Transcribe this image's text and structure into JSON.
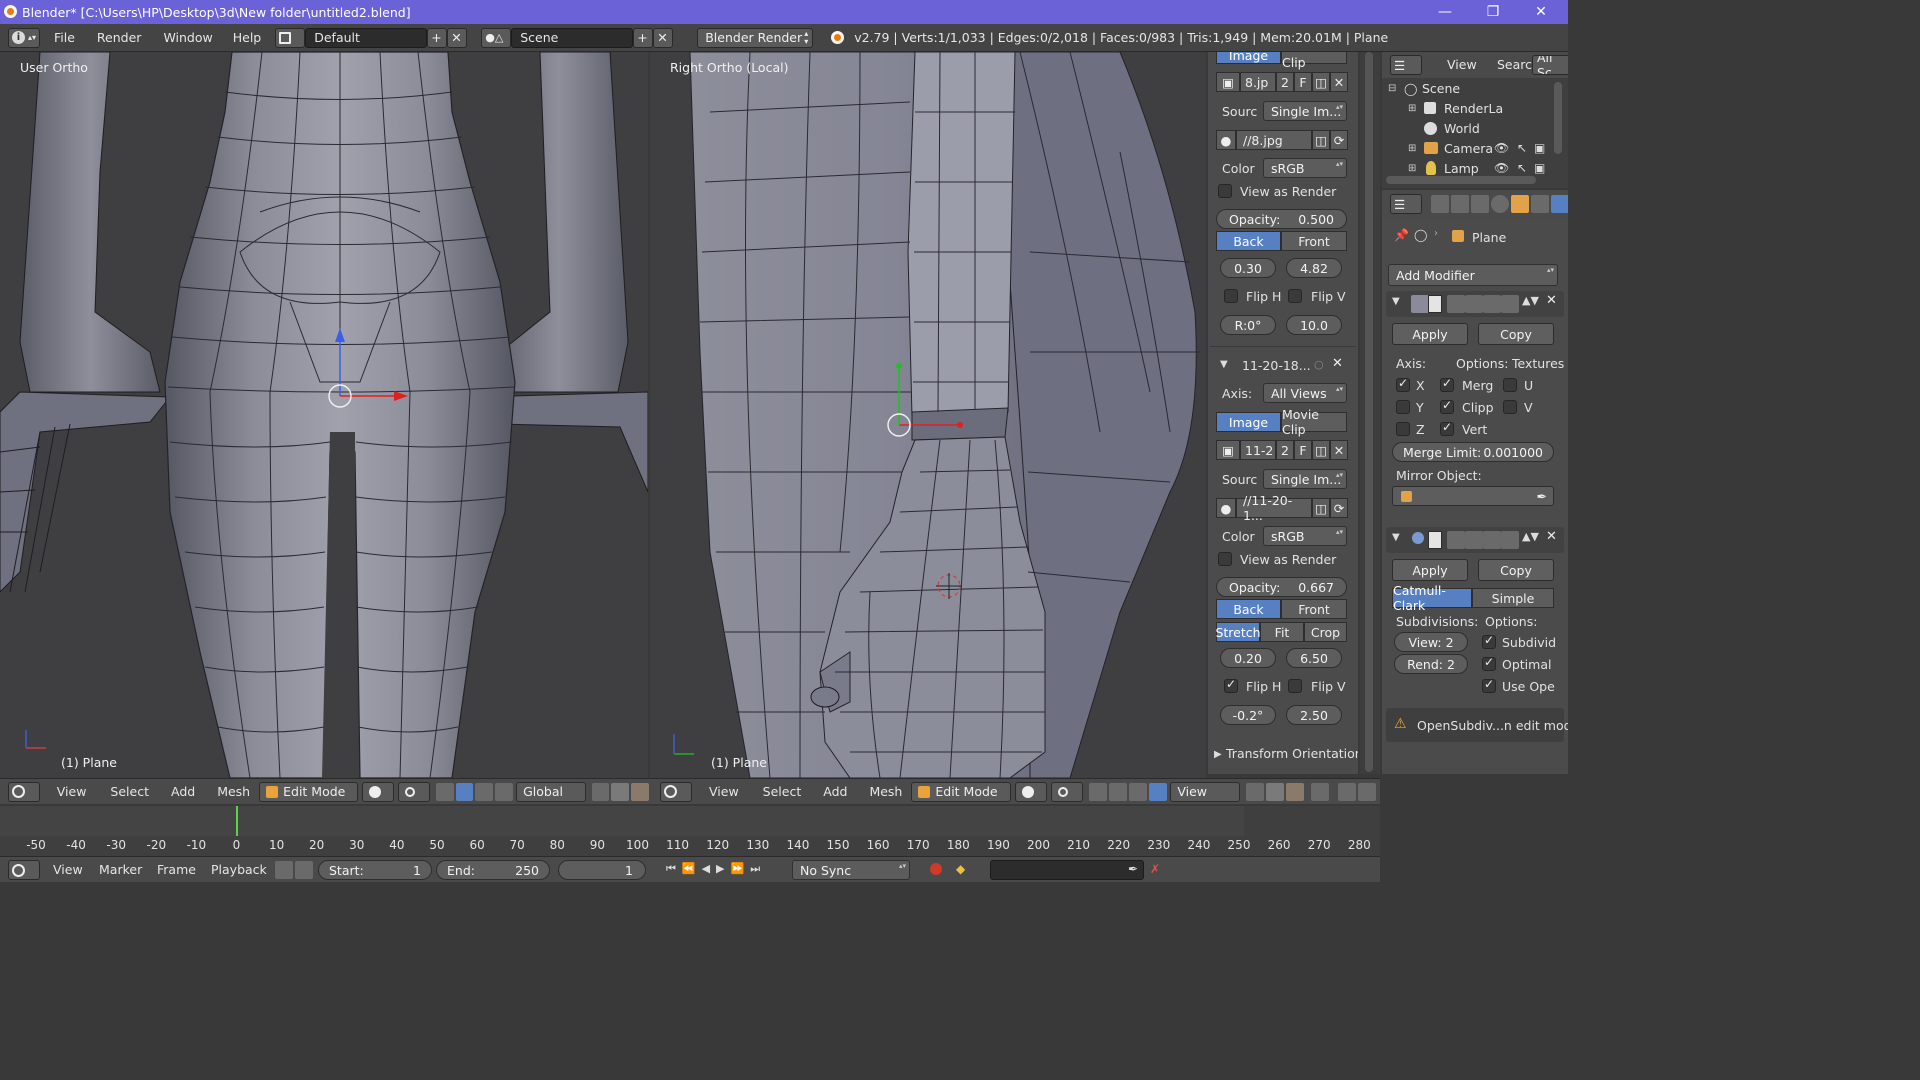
{
  "window": {
    "title": "Blender* [C:\\Users\\HP\\Desktop\\3d\\New folder\\untitled2.blend]",
    "minimize": "—",
    "maximize": "❐",
    "close": "✕"
  },
  "info_header": {
    "menus": [
      "File",
      "Render",
      "Window",
      "Help"
    ],
    "layout": "Default",
    "scene": "Scene",
    "engine": "Blender Render",
    "stats": "v2.79 | Verts:1/1,033 | Edges:0/2,018 | Faces:0/983 | Tris:1,949 | Mem:20.01M | Plane"
  },
  "viewport_left": {
    "label": "User Ortho",
    "object": "(1) Plane",
    "header": {
      "menus": [
        "View",
        "Select",
        "Add",
        "Mesh"
      ],
      "mode": "Edit Mode",
      "orientation": "Global"
    }
  },
  "viewport_right": {
    "label": "Right Ortho (Local)",
    "object": "(1) Plane",
    "header": {
      "menus": [
        "View",
        "Select",
        "Add",
        "Mesh"
      ],
      "mode": "Edit Mode",
      "orientation": "View"
    }
  },
  "background_images": {
    "top_tabs": [
      "Image",
      "Movie Clip"
    ],
    "img1": {
      "file_name": "8.jp",
      "users": "2",
      "fake": "F",
      "source_label": "Sourc",
      "source": "Single Im...",
      "path": "//8.jpg",
      "color_label": "Color",
      "color": "sRGB",
      "view_as_render": "View as Render",
      "opacity_label": "Opacity:",
      "opacity": "0.500",
      "back": "Back",
      "front": "Front",
      "x": "0.30",
      "y": "4.82",
      "flip_h": "Flip H",
      "flip_v": "Flip V",
      "rotation": "R:0°",
      "size": "10.0"
    },
    "img2": {
      "name": "11-20-18...",
      "axis_label": "Axis:",
      "axis": "All Views",
      "tabs": [
        "Image",
        "Movie Clip"
      ],
      "file_name": "11-2",
      "users": "2",
      "fake": "F",
      "source_label": "Sourc",
      "source": "Single Im...",
      "path": "//11-20-1...",
      "color_label": "Color",
      "color": "sRGB",
      "view_as_render": "View as Render",
      "opacity_label": "Opacity:",
      "opacity": "0.667",
      "back": "Back",
      "front": "Front",
      "fit_modes": [
        "Stretch",
        "Fit",
        "Crop"
      ],
      "x": "0.20",
      "y": "6.50",
      "flip_h": "Flip H",
      "flip_v": "Flip V",
      "rotation": "-0.2°",
      "size": "2.50"
    },
    "transform_orientations": "Transform Orientations"
  },
  "outliner": {
    "menus": [
      "View",
      "Search",
      "All Sc"
    ],
    "items": [
      {
        "label": "Scene"
      },
      {
        "label": "RenderLa"
      },
      {
        "label": "World"
      },
      {
        "label": "Camera"
      },
      {
        "label": "Lamp"
      }
    ]
  },
  "properties": {
    "object_name": "Plane",
    "add_modifier": "Add Modifier",
    "mirror": {
      "apply": "Apply",
      "copy": "Copy",
      "axis_label": "Axis:",
      "options_label": "Options:",
      "textures_label": "Textures",
      "x": "X",
      "y": "Y",
      "z": "Z",
      "merge": "Merg",
      "clipping": "Clipp",
      "vertex": "Vert",
      "u": "U",
      "v": "V",
      "merge_limit_label": "Merge Limit:",
      "merge_limit": "0.001000",
      "mirror_object_label": "Mirror Object:"
    },
    "subsurf": {
      "apply": "Apply",
      "copy": "Copy",
      "tabs": [
        "Catmull-Clark",
        "Simple"
      ],
      "subdivisions_label": "Subdivisions:",
      "options_label": "Options:",
      "view": "View: 2",
      "render": "Rend: 2",
      "subdivide_uvs": "Subdivid",
      "optimal": "Optimal",
      "use_opensubdiv": "Use Ope",
      "warning": "OpenSubdiv...n edit mode"
    }
  },
  "timeline": {
    "ticks": [
      "-50",
      "-40",
      "-30",
      "-20",
      "-10",
      "0",
      "10",
      "20",
      "30",
      "40",
      "50",
      "60",
      "70",
      "80",
      "90",
      "100",
      "110",
      "120",
      "130",
      "140",
      "150",
      "160",
      "170",
      "180",
      "190",
      "200",
      "210",
      "220",
      "230",
      "240",
      "250",
      "260",
      "270",
      "280"
    ],
    "menus": [
      "View",
      "Marker",
      "Frame",
      "Playback"
    ],
    "start_label": "Start:",
    "start": "1",
    "end_label": "End:",
    "end": "250",
    "current": "1",
    "sync": "No Sync"
  },
  "colors": {
    "title_bar": "#6b62d8",
    "header": "#444444",
    "panel": "#4b4b4b",
    "viewport": "#3f3f42",
    "accent_blue": "#5680c2",
    "mesh": "#8f909c"
  }
}
